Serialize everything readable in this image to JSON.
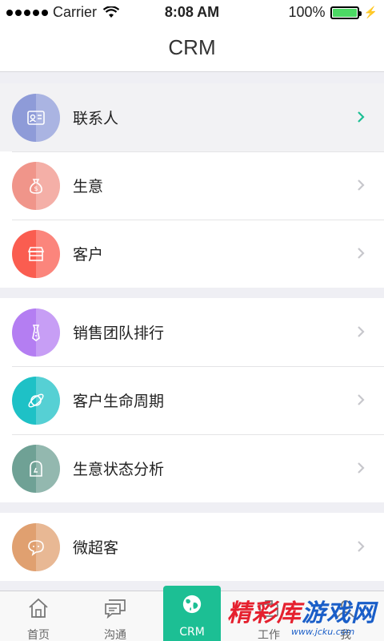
{
  "status_bar": {
    "carrier": "Carrier",
    "time": "8:08 AM",
    "battery": "100%"
  },
  "nav": {
    "title": "CRM"
  },
  "groups": [
    {
      "items": [
        {
          "label": "联系人",
          "icon": "contact-card-icon",
          "color": "#8e9bd8",
          "highlighted": true
        },
        {
          "label": "生意",
          "icon": "money-bag-icon",
          "color": "#f0958a"
        },
        {
          "label": "客户",
          "icon": "store-icon",
          "color": "#fa5d50"
        }
      ]
    },
    {
      "items": [
        {
          "label": "销售团队排行",
          "icon": "tie-icon",
          "color": "#b47ef2"
        },
        {
          "label": "客户生命周期",
          "icon": "planet-icon",
          "color": "#1ec1c6"
        },
        {
          "label": "生意状态分析",
          "icon": "tombstone-icon",
          "color": "#6fa195"
        }
      ]
    },
    {
      "items": [
        {
          "label": "微超客",
          "icon": "chat-bubble-icon",
          "color": "#e0a070"
        }
      ]
    }
  ],
  "tabs": [
    {
      "label": "首页",
      "icon": "home-icon"
    },
    {
      "label": "沟通",
      "icon": "message-icon"
    },
    {
      "label": "CRM",
      "icon": "globe-icon",
      "active": true
    },
    {
      "label": "工作",
      "icon": "work-icon"
    },
    {
      "label": "我",
      "icon": "me-icon"
    }
  ],
  "watermark": {
    "text_red": "精彩库",
    "text_blue": "游戏网",
    "url": "www.jcku.com"
  },
  "colors": {
    "accent": "#1cbf94",
    "chevron_active": "#1cbf94",
    "chevron": "#c7c7cc"
  }
}
